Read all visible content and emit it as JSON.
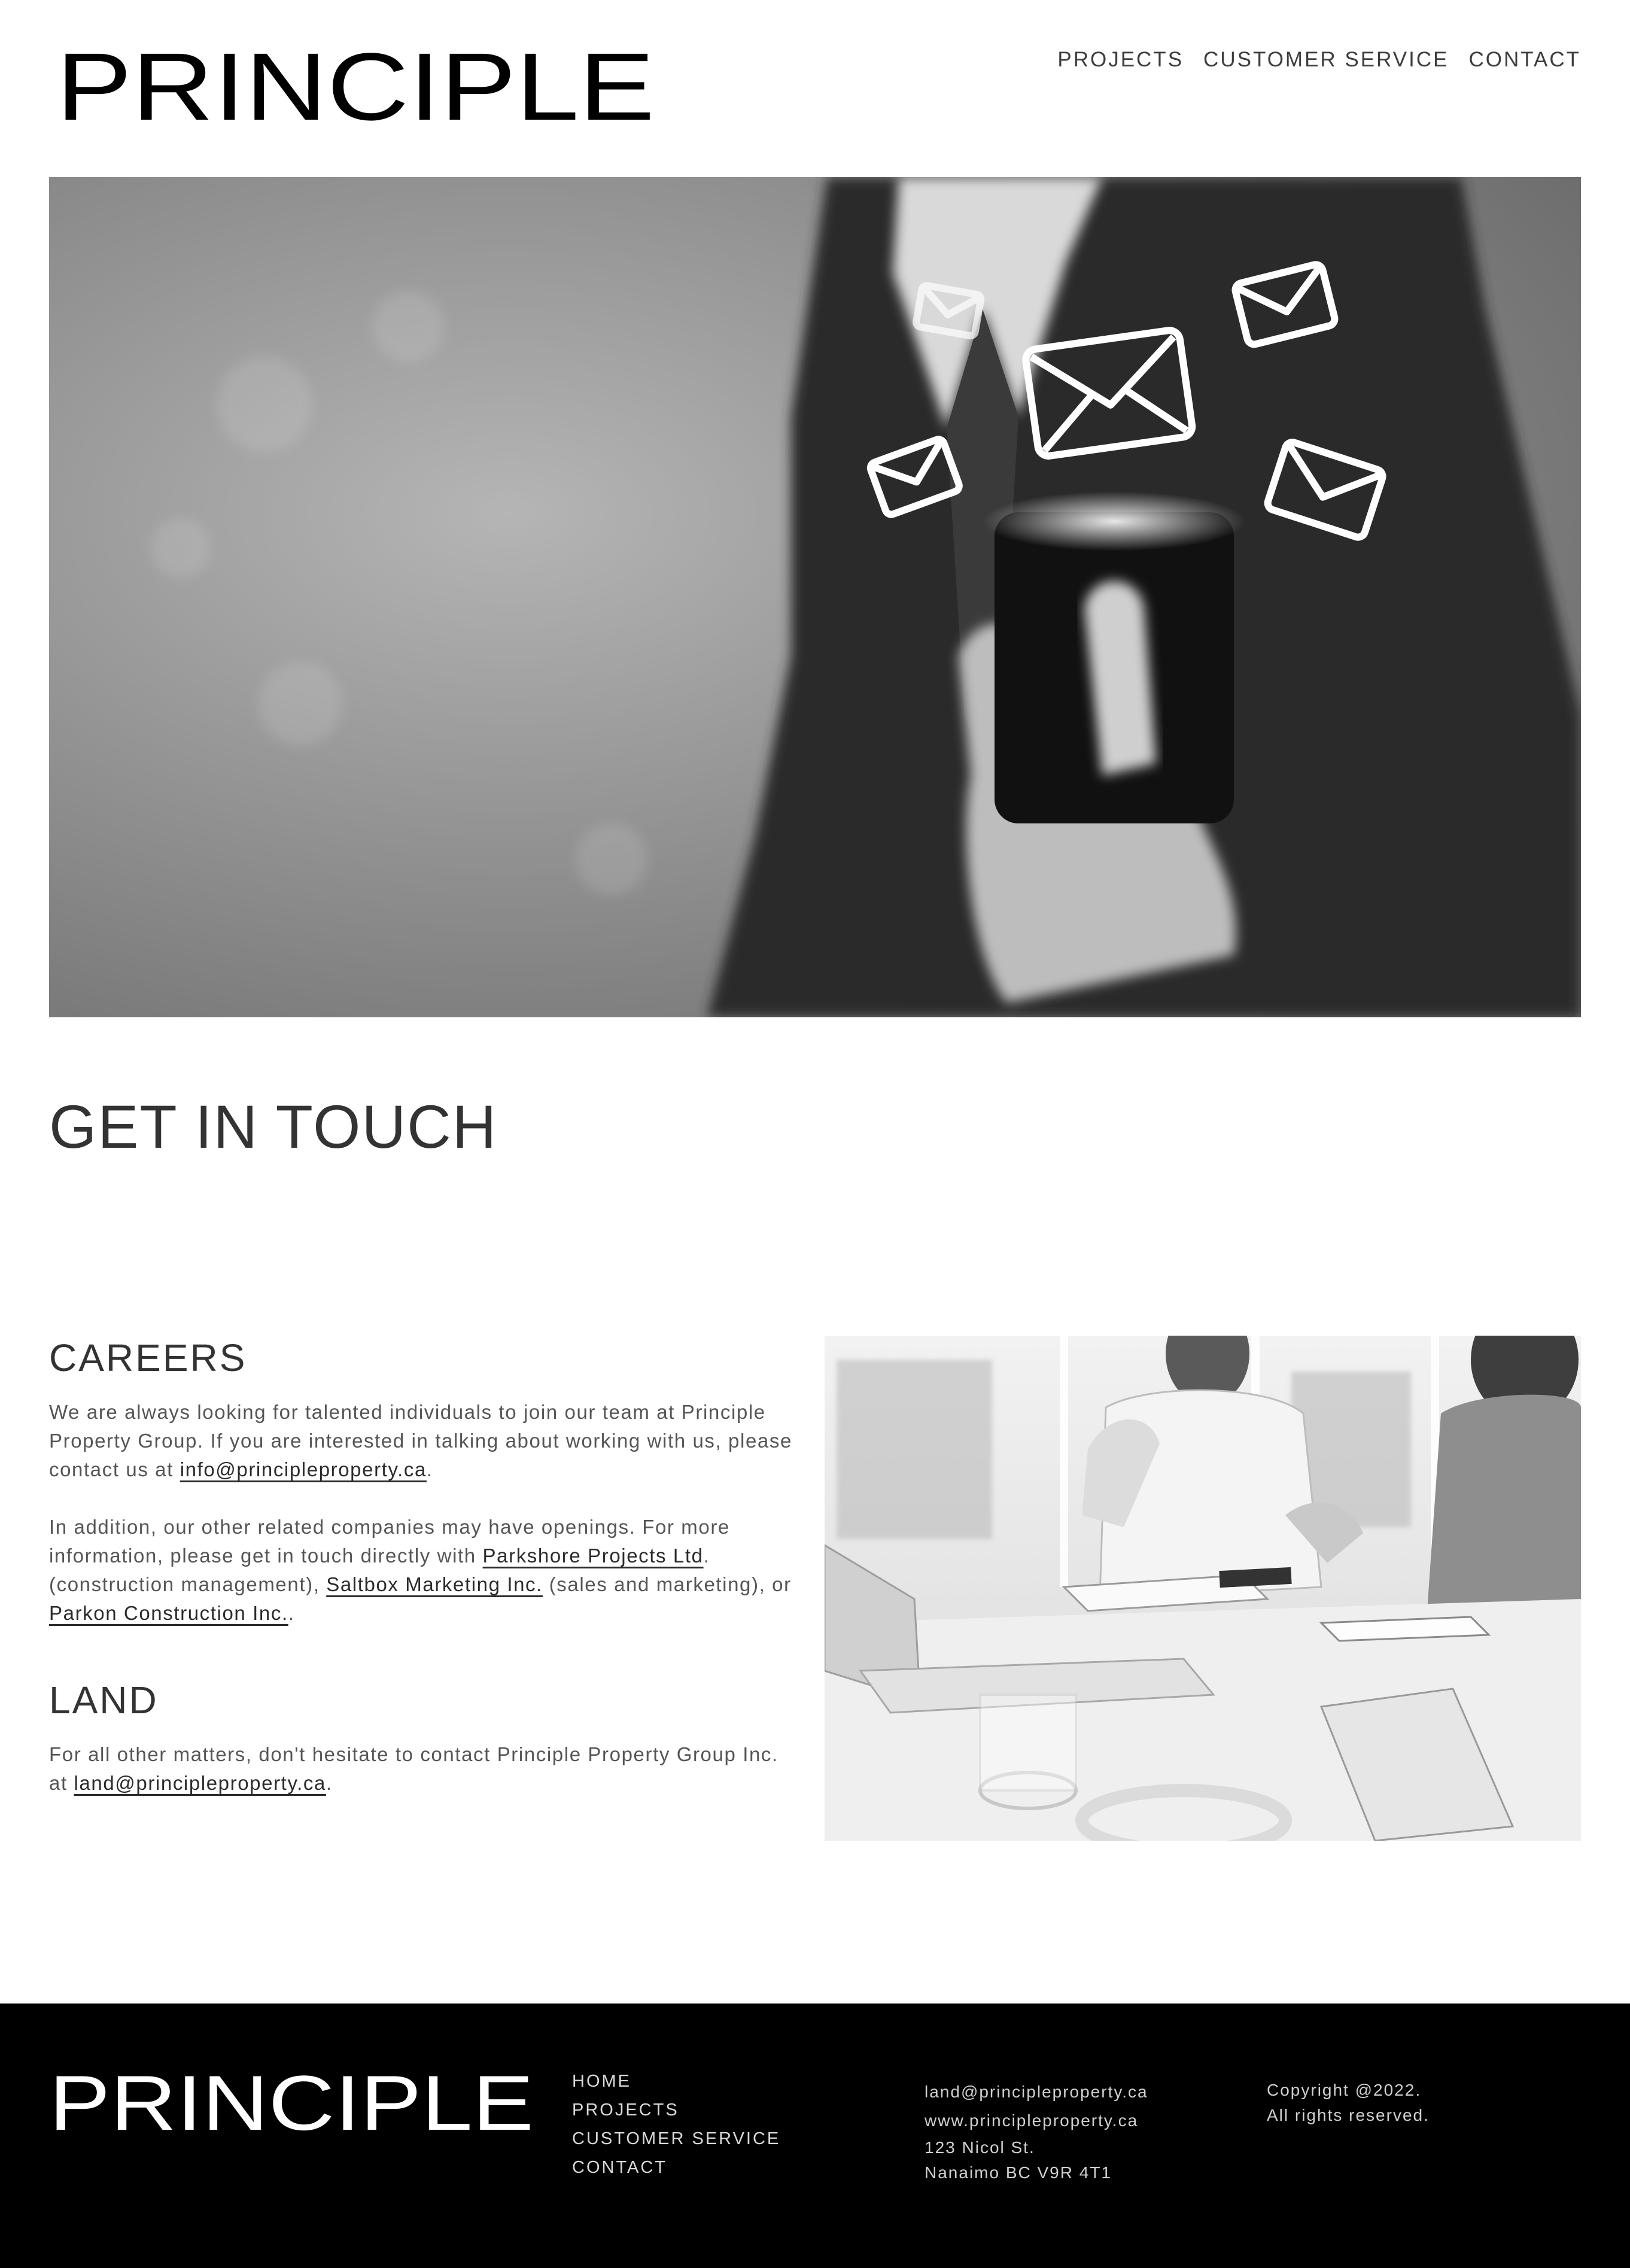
{
  "header": {
    "logo_text": "PRINCIPLE",
    "nav": [
      {
        "label": "PROJECTS"
      },
      {
        "label": "CUSTOMER SERVICE"
      },
      {
        "label": "CONTACT"
      }
    ]
  },
  "main": {
    "title": "GET IN TOUCH",
    "careers": {
      "heading": "CAREERS",
      "p1_text": "We are always looking for talented individuals to join our team at Principle Property Group. If you are interested in talking about working with us, please contact us at ",
      "p1_link": "info@principleproperty.ca",
      "p1_end": ".",
      "p2_text": "In addition, our other related companies may have openings. For more information, please get in touch directly with ",
      "link_parkshore": "Parkshore Projects Ltd",
      "p2_mid1": ". (construction management), ",
      "link_saltbox": "Saltbox Marketing Inc.",
      "p2_mid2": " (sales and marketing), or ",
      "link_parkon": "Parkon Construction Inc.",
      "p2_end": "."
    },
    "land": {
      "heading": "LAND",
      "text": "For all other matters, don't hesitate to contact Principle Property Group Inc. at ",
      "link": "land@principleproperty.ca",
      "end": "."
    }
  },
  "footer": {
    "logo_text": "PRINCIPLE",
    "nav": [
      {
        "label": "HOME"
      },
      {
        "label": "PROJECTS"
      },
      {
        "label": "CUSTOMER SERVICE"
      },
      {
        "label": "CONTACT"
      }
    ],
    "email": "land@principleproperty.ca",
    "website": "www.principleproperty.ca",
    "address_line1": "123 Nicol St.",
    "address_line2": "Nanaimo BC V9R 4T1",
    "copyright_line1": "Copyright @2022.",
    "copyright_line2": "All rights reserved."
  },
  "colors": {
    "background": "#ffffff",
    "text": "#3a3a3a",
    "footer_bg": "#000000"
  }
}
